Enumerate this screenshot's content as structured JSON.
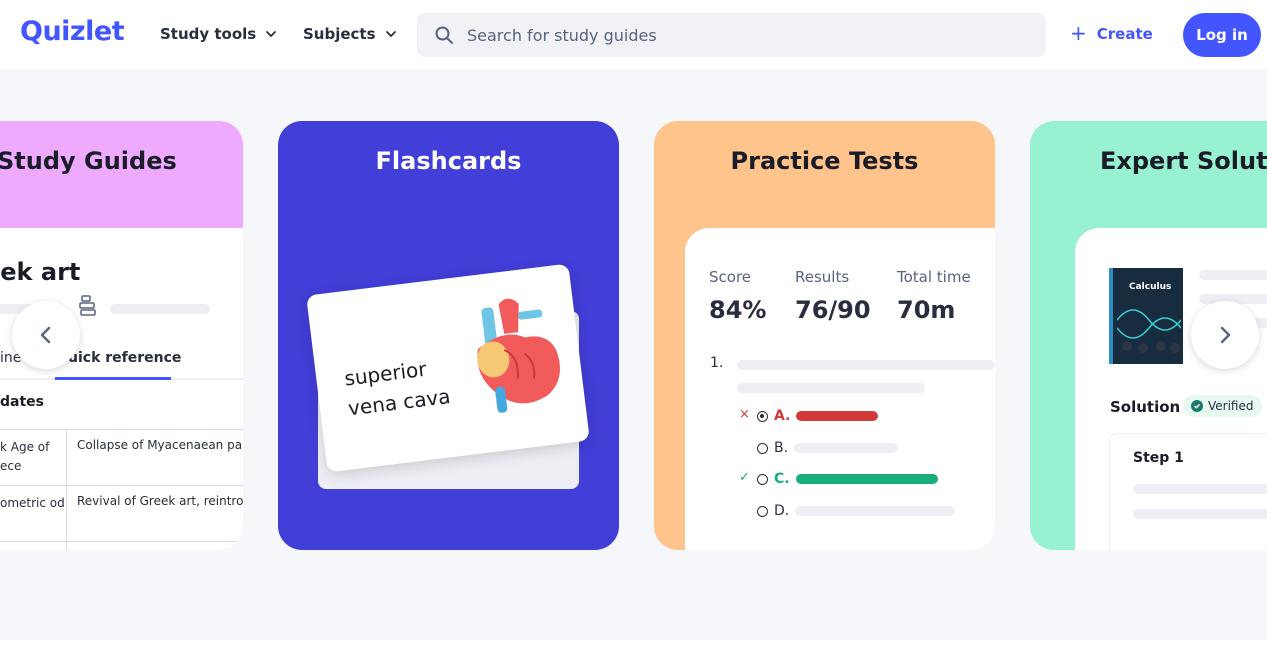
{
  "header": {
    "logo": "Quizlet",
    "nav": [
      {
        "label": "Study tools"
      },
      {
        "label": "Subjects"
      }
    ],
    "search_placeholder": "Search for study guides",
    "create_label": "Create",
    "login_label": "Log in"
  },
  "cards": {
    "study_guides": {
      "title": "Study Guides",
      "heading": "eek art",
      "tab_a": "ine",
      "tab_b": "uick reference",
      "subhead": "dates",
      "rows": [
        {
          "c1": "k Age of ece",
          "c2": "Collapse of Myacenaean pal"
        },
        {
          "c1": "ometric od",
          "c2": "Revival of Greek art, reintroc"
        }
      ]
    },
    "flashcards": {
      "title": "Flashcards",
      "card_line1": "superior",
      "card_line2": "vena cava"
    },
    "practice_tests": {
      "title": "Practice Tests",
      "score_label": "Score",
      "score_value": "84%",
      "results_label": "Results",
      "results_value": "76/90",
      "time_label": "Total time",
      "time_value": "70m",
      "question_number": "1.",
      "options": [
        {
          "label": "A.",
          "mark": "×",
          "state": "incorrect",
          "color": "#d23a3a"
        },
        {
          "label": "B.",
          "mark": "",
          "state": "neutral",
          "color": "#edeff4"
        },
        {
          "label": "C.",
          "mark": "✓",
          "state": "correct",
          "color": "#18ae79"
        },
        {
          "label": "D.",
          "mark": "",
          "state": "neutral",
          "color": "#edeff4"
        }
      ]
    },
    "expert_solutions": {
      "title": "Expert Solutio",
      "book_title": "Calculus",
      "solution_label": "Solution",
      "verified_label": "Verified",
      "step_label": "Step 1"
    }
  },
  "colors": {
    "brand": "#4255ff",
    "study_guides_bg": "#eeaaff",
    "flashcards_bg": "#423ed8",
    "practice_tests_bg": "#ffc38c",
    "expert_solutions_bg": "#98f1d1"
  }
}
